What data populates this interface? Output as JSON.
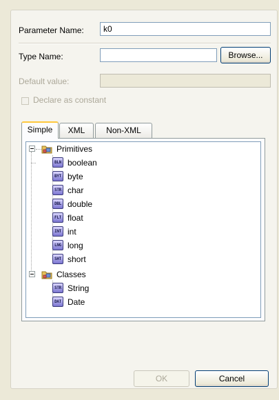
{
  "form": {
    "parameter_name_label": "Parameter Name:",
    "parameter_name_value": "k0",
    "type_name_label": "Type Name:",
    "type_name_value": "",
    "browse_label": "Browse...",
    "default_value_label": "Default value:",
    "default_value_value": "",
    "declare_constant_label": "Declare as constant",
    "declare_constant_checked": false
  },
  "tabs": [
    {
      "label": "Simple",
      "active": true
    },
    {
      "label": "XML",
      "active": false
    },
    {
      "label": "Non-XML",
      "active": false
    }
  ],
  "tree": {
    "groups": [
      {
        "label": "Primitives",
        "expanded": true,
        "items": [
          {
            "label": "boolean",
            "icon": "BLN"
          },
          {
            "label": "byte",
            "icon": "BYT"
          },
          {
            "label": "char",
            "icon": "STR"
          },
          {
            "label": "double",
            "icon": "DBL"
          },
          {
            "label": "float",
            "icon": "FLT"
          },
          {
            "label": "int",
            "icon": "INT"
          },
          {
            "label": "long",
            "icon": "LNG"
          },
          {
            "label": "short",
            "icon": "SHT"
          }
        ]
      },
      {
        "label": "Classes",
        "expanded": true,
        "items": [
          {
            "label": "String",
            "icon": "STR"
          },
          {
            "label": "Date",
            "icon": "DAT"
          }
        ]
      }
    ]
  },
  "buttons": {
    "ok_label": "OK",
    "ok_enabled": false,
    "cancel_label": "Cancel"
  },
  "colors": {
    "dialog_bg": "#ece9d8",
    "field_border": "#7f9db9",
    "active_tab_accent": "#ffc83c",
    "type_icon": "#7a74d0"
  }
}
